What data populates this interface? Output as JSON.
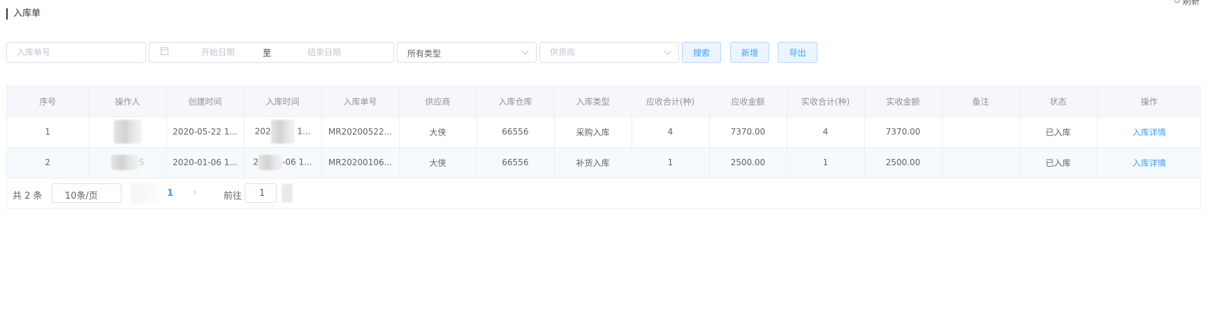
{
  "page": {
    "title": "入库单",
    "refresh_label": "刷新"
  },
  "filters": {
    "order_no_placeholder": "入库单号",
    "start_date_placeholder": "开始日期",
    "range_separator": "至",
    "end_date_placeholder": "结束日期",
    "type_select_value": "所有类型",
    "supplier_placeholder": "供货商",
    "search_label": "搜索",
    "add_label": "新增",
    "export_label": "导出"
  },
  "table": {
    "columns": [
      "序号",
      "操作人",
      "创建时间",
      "入库时间",
      "入库单号",
      "供应商",
      "入库仓库",
      "入库类型",
      "应收合计(种)",
      "应收金额",
      "实收合计(种)",
      "实收金额",
      "备注",
      "状态",
      "操作"
    ],
    "rows": [
      {
        "index": "1",
        "operator": "",
        "created": "2020-05-22 1...",
        "stock_in_time_a": "202",
        "stock_in_time_b": " 1...",
        "order_no": "MR20200522...",
        "supplier": "大侠",
        "warehouse": "66556",
        "type": "采购入库",
        "due_kinds": "4",
        "due_amount": "7370.00",
        "received_kinds": "4",
        "received_amount": "7370.00",
        "remark": "",
        "status": "已入库",
        "action": "入库详情"
      },
      {
        "index": "2",
        "operator": "S",
        "created": "2020-01-06 1...",
        "stock_in_time_a": "2",
        "stock_in_time_b": "-06 1...",
        "order_no": "MR20200106...",
        "supplier": "大侠",
        "warehouse": "66556",
        "type": "补货入库",
        "due_kinds": "1",
        "due_amount": "2500.00",
        "received_kinds": "1",
        "received_amount": "2500.00",
        "remark": "",
        "status": "已入库",
        "action": "入库详情"
      }
    ]
  },
  "pagination": {
    "total_text": "共 2 条",
    "page_size": "10条/页",
    "current_page": "1",
    "next_icon": "chevron-right-icon",
    "goto_label": "前往",
    "goto_value": "1"
  },
  "colors": {
    "accent": "#409eff",
    "header_bg": "#f5f7fa",
    "border": "#ebeef5"
  }
}
